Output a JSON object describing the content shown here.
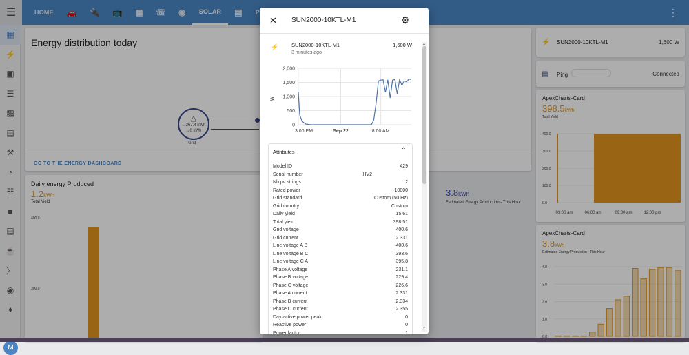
{
  "nav": {
    "tabs": [
      {
        "label": "HOME",
        "type": "text"
      },
      {
        "label": "car-icon",
        "type": "icon"
      },
      {
        "label": "plug-icon",
        "type": "icon"
      },
      {
        "label": "tv-icon",
        "type": "icon"
      },
      {
        "label": "grid-icon",
        "type": "icon"
      },
      {
        "label": "router-icon",
        "type": "icon"
      },
      {
        "label": "antenna-icon",
        "type": "icon"
      },
      {
        "label": "SOLAR",
        "type": "text"
      },
      {
        "label": "panel-icon",
        "type": "icon"
      },
      {
        "label": "PRAYER",
        "type": "text"
      }
    ],
    "active_tab": "SOLAR"
  },
  "main": {
    "title": "Energy distribution today",
    "grid_in": "←267.4 kWh",
    "grid_out": "→0 kWh",
    "grid_label": "Grid",
    "dashboard_link": "GO TO THE ENERGY DASHBOARD"
  },
  "daily": {
    "title": "Daily energy Produced",
    "value": "1.2",
    "unit": "kWh",
    "sub": "Total Yield",
    "tick_400": "400.0",
    "tick_300": "300.0"
  },
  "estimate": {
    "value": "3.8",
    "unit": "kWh",
    "sub": "Estimated Energy Production - This Hour"
  },
  "right": {
    "entity_name": "SUN2000-10KTL-M1",
    "entity_value": "1,600 W",
    "ping_label": "Ping",
    "ping_status": "Connected",
    "apex1": {
      "title": "ApexCharts-Card",
      "value": "398.5",
      "unit": "kWh",
      "sub": "Total Yield"
    },
    "apex2": {
      "title": "ApexCharts-Card",
      "value": "3.8",
      "unit": "kWh",
      "sub": "Estimated Energy Production - This Hour"
    }
  },
  "dialog": {
    "title": "SUN2000-10KTL-M1",
    "entity_name": "SUN2000-10KTL-M1",
    "entity_time": "3 minutes ago",
    "entity_value": "1,600 W",
    "attributes_header": "Attributes",
    "attributes": [
      {
        "name": "Model ID",
        "value": "429",
        "align": "right"
      },
      {
        "name": "Serial number",
        "value": "HV2",
        "align": "mid"
      },
      {
        "name": "Nb pv strings",
        "value": "2",
        "align": "right"
      },
      {
        "name": "Rated power",
        "value": "10000",
        "align": "right"
      },
      {
        "name": "Grid standard",
        "value": "Custom (50 Hz)",
        "align": "right"
      },
      {
        "name": "Grid country",
        "value": "Custom",
        "align": "right"
      },
      {
        "name": "Daily yield",
        "value": "15.61",
        "align": "right"
      },
      {
        "name": "Total yield",
        "value": "398.51",
        "align": "right"
      },
      {
        "name": "Grid voltage",
        "value": "400.6",
        "align": "right"
      },
      {
        "name": "Grid current",
        "value": "2.331",
        "align": "right"
      },
      {
        "name": "Line voltage A B",
        "value": "400.6",
        "align": "right"
      },
      {
        "name": "Line voltage B C",
        "value": "393.6",
        "align": "right"
      },
      {
        "name": "Line voltage C A",
        "value": "395.8",
        "align": "right"
      },
      {
        "name": "Phase A voltage",
        "value": "231.1",
        "align": "right"
      },
      {
        "name": "Phase B voltage",
        "value": "229.4",
        "align": "right"
      },
      {
        "name": "Phase C voltage",
        "value": "226.6",
        "align": "right"
      },
      {
        "name": "Phase A current",
        "value": "2.331",
        "align": "right"
      },
      {
        "name": "Phase B current",
        "value": "2.334",
        "align": "right"
      },
      {
        "name": "Phase C current",
        "value": "2.355",
        "align": "right"
      },
      {
        "name": "Day active power peak",
        "value": "0",
        "align": "right"
      },
      {
        "name": "Reactive power",
        "value": "0",
        "align": "right"
      },
      {
        "name": "Power factor",
        "value": "1",
        "align": "right"
      }
    ]
  },
  "chart_data": [
    {
      "type": "line",
      "ylabel": "W",
      "ylim": [
        0,
        2000
      ],
      "y_ticks": [
        "0",
        "500",
        "1,000",
        "1,500",
        "2,000"
      ],
      "x_ticks": [
        "3:00 PM",
        "Sep 22",
        "8:00 AM"
      ],
      "series": [
        {
          "x": [
            0,
            0.3,
            0.8,
            1.5,
            2.5,
            4,
            6,
            8,
            10,
            12,
            14,
            15.5,
            16,
            16.5,
            17,
            17.5,
            18,
            18.5,
            19,
            19.5,
            20,
            20.5,
            21,
            21.5,
            22,
            22.5,
            23,
            23.5,
            24
          ],
          "y": [
            1150,
            350,
            120,
            30,
            0,
            0,
            0,
            0,
            0,
            0,
            0,
            0,
            150,
            750,
            1550,
            1580,
            1590,
            1150,
            1590,
            950,
            1580,
            1600,
            1100,
            1590,
            1400,
            1550,
            1520,
            1620,
            1600
          ]
        }
      ]
    },
    {
      "type": "bar",
      "title": "ApexCharts-Card",
      "y_ticks": [
        "0.0",
        "100.0",
        "200.0",
        "300.0",
        "400.0"
      ],
      "x_ticks": [
        "03:00 am",
        "06:00 am",
        "09:00 am",
        "12:00 pm"
      ],
      "ylim": [
        0,
        400
      ],
      "values": [
        398.5,
        398.5
      ]
    },
    {
      "type": "bar",
      "title": "ApexCharts-Card",
      "y_ticks": [
        "0.0",
        "1.0",
        "2.0",
        "3.0",
        "4.0"
      ],
      "ylim": [
        0,
        4
      ],
      "values": [
        0.02,
        0,
        0,
        0.02,
        0.25,
        0.7,
        1.6,
        2.1,
        2.3,
        3.9,
        3.3,
        3.85,
        3.95,
        3.95,
        3.8
      ]
    }
  ]
}
